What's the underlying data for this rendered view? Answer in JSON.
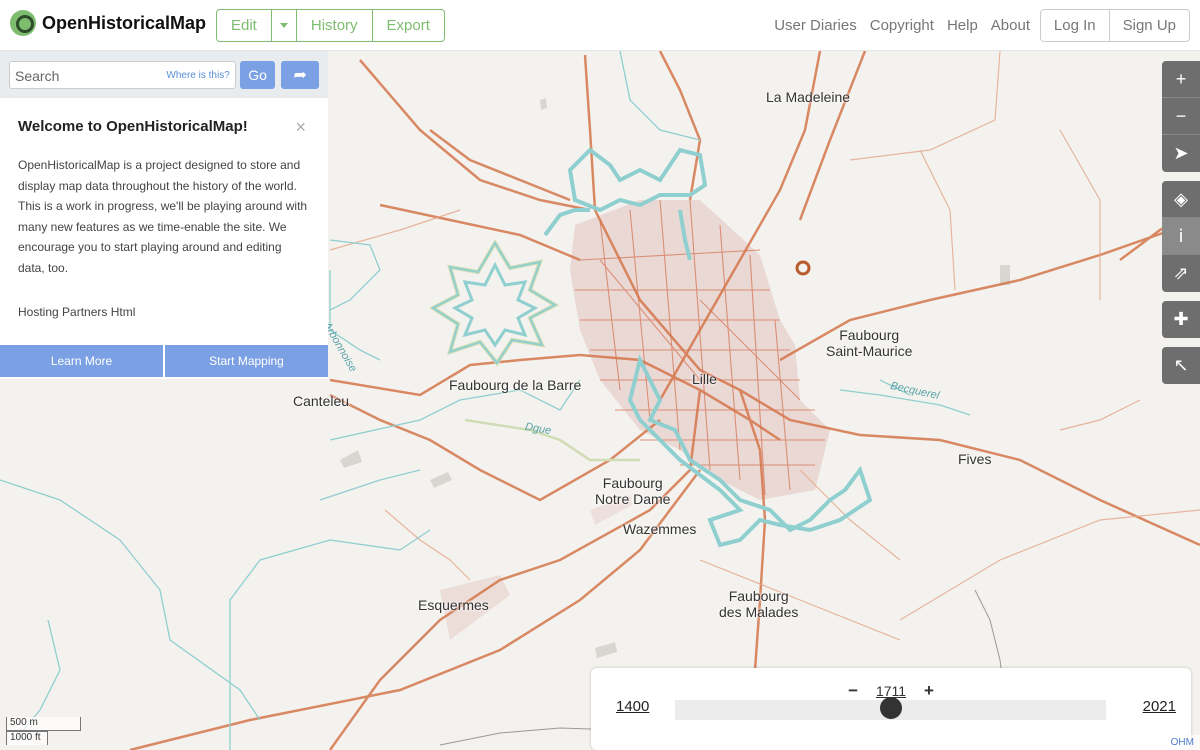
{
  "header": {
    "logo_text": "OpenHistoricalMap",
    "edit_label": "Edit",
    "history_label": "History",
    "export_label": "Export",
    "nav": [
      "User Diaries",
      "Copyright",
      "Help",
      "About"
    ],
    "login_label": "Log In",
    "signup_label": "Sign Up"
  },
  "search": {
    "placeholder": "Search",
    "where_is_this": "Where is this?",
    "go_label": "Go"
  },
  "welcome": {
    "title": "Welcome to OpenHistoricalMap!",
    "body": "OpenHistoricalMap is a project designed to store and display map data throughout the history of the world. This is a work in progress, we'll be playing around with many new features as we time-enable the site. We encourage you to start playing around and editing data, too.",
    "partners": "Hosting Partners Html",
    "learn_more": "Learn More",
    "start_mapping": "Start Mapping"
  },
  "map_labels": [
    {
      "text": "La Madeleine"
    },
    {
      "text": "Faubourg\nSaint-Maurice"
    },
    {
      "text": "Faubourg de la Barre"
    },
    {
      "text": "Lille"
    },
    {
      "text": "Canteleu"
    },
    {
      "text": "Fives"
    },
    {
      "text": "Faubourg\nNotre Dame"
    },
    {
      "text": "Wazemmes"
    },
    {
      "text": "Esquermes"
    },
    {
      "text": "Faubourg\ndes Malades"
    }
  ],
  "water_labels": [
    "Becquerel",
    "Dgue",
    "Arbonnoise"
  ],
  "timeslider": {
    "year": "1711",
    "start": "1400",
    "end": "2021",
    "year_value": 1711,
    "min": 1400,
    "max": 2021
  },
  "scale": {
    "metric": "500 m",
    "imperial": "1000 ft"
  },
  "attribution": "OHM",
  "colors": {
    "brand": "#7ebc6f",
    "button": "#7ba1e4",
    "road": "#d4764b",
    "water": "#8fcfcf",
    "city": "#e8d4d0"
  }
}
